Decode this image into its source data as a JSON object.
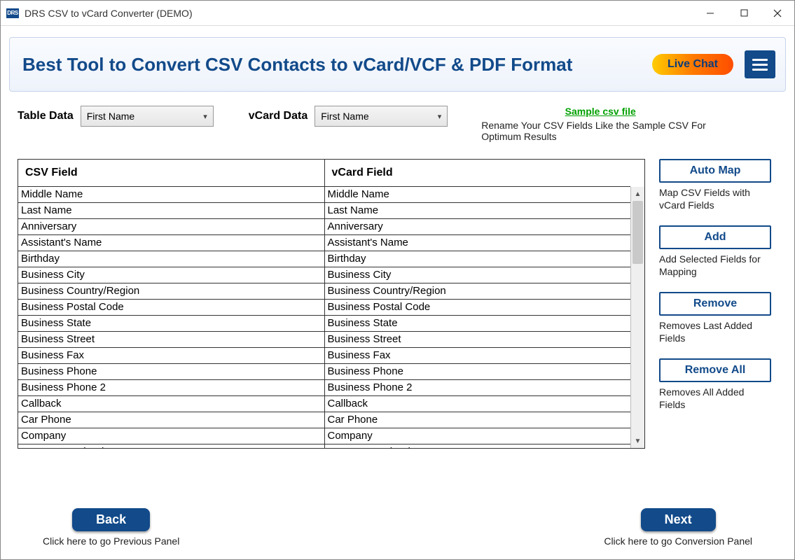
{
  "window": {
    "title": "DRS CSV to vCard Converter (DEMO)",
    "icon_text": "DRS"
  },
  "banner": {
    "title": "Best Tool to Convert CSV Contacts to vCard/VCF & PDF Format",
    "live_chat": "Live Chat"
  },
  "controls": {
    "table_data_label": "Table Data",
    "table_data_value": "First Name",
    "vcard_data_label": "vCard Data",
    "vcard_data_value": "First Name",
    "sample_link": "Sample csv file",
    "sample_hint": "Rename Your CSV Fields Like the Sample CSV For Optimum Results"
  },
  "table": {
    "col_csv": "CSV Field",
    "col_vcard": "vCard Field",
    "rows": [
      {
        "csv": "Middle Name",
        "vcard": "Middle Name"
      },
      {
        "csv": "Last Name",
        "vcard": "Last Name"
      },
      {
        "csv": "Anniversary",
        "vcard": "Anniversary"
      },
      {
        "csv": "Assistant's Name",
        "vcard": "Assistant's Name"
      },
      {
        "csv": "Birthday",
        "vcard": "Birthday"
      },
      {
        "csv": "Business City",
        "vcard": "Business City"
      },
      {
        "csv": "Business Country/Region",
        "vcard": "Business Country/Region"
      },
      {
        "csv": "Business Postal Code",
        "vcard": "Business Postal Code"
      },
      {
        "csv": "Business State",
        "vcard": "Business State"
      },
      {
        "csv": "Business Street",
        "vcard": "Business Street"
      },
      {
        "csv": "Business Fax",
        "vcard": "Business Fax"
      },
      {
        "csv": "Business Phone",
        "vcard": "Business Phone"
      },
      {
        "csv": "Business Phone 2",
        "vcard": "Business Phone 2"
      },
      {
        "csv": "Callback",
        "vcard": "Callback"
      },
      {
        "csv": "Car Phone",
        "vcard": "Car Phone"
      },
      {
        "csv": "Company",
        "vcard": "Company"
      },
      {
        "csv": "Company Main Phone",
        "vcard": "Company Main Phone"
      }
    ]
  },
  "side": {
    "automap_label": "Auto Map",
    "automap_desc": "Map CSV Fields with vCard Fields",
    "add_label": "Add",
    "add_desc": "Add Selected Fields for Mapping",
    "remove_label": "Remove",
    "remove_desc": "Removes Last Added Fields",
    "removeall_label": "Remove All",
    "removeall_desc": "Removes All Added Fields"
  },
  "footer": {
    "back_label": "Back",
    "back_hint": "Click here to go Previous Panel",
    "next_label": "Next",
    "next_hint": "Click here to go Conversion Panel"
  }
}
